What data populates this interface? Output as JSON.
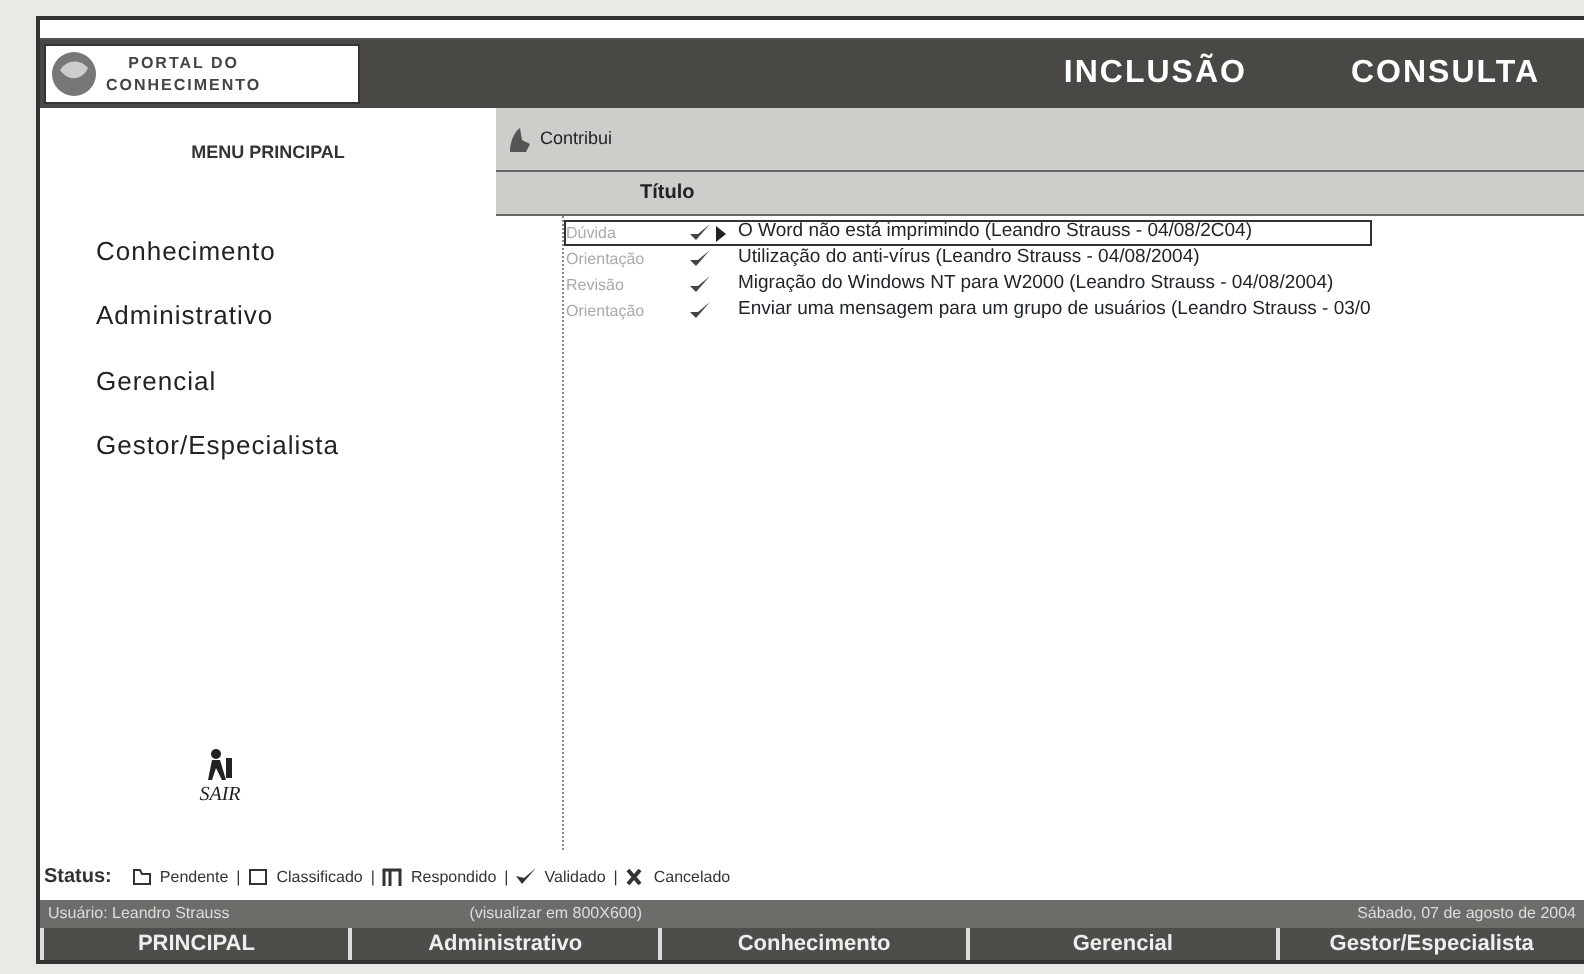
{
  "header": {
    "logo_text": [
      "PORTAL DO",
      "CONHECIMENTO"
    ],
    "links": [
      "INCLUSÃO",
      "CONSULTA"
    ]
  },
  "sidebar": {
    "title": "MENU PRINCIPAL",
    "items": [
      "Conhecimento",
      "Administrativo",
      "Gerencial",
      "Gestor/Especialista"
    ],
    "exit": "SAIR"
  },
  "toolbar": {
    "button": "Contribui"
  },
  "table": {
    "column": "Título",
    "rows": [
      {
        "category": "Dúvida",
        "title": "O Word não está imprimindo  (Leandro Strauss - 04/08/2C04)",
        "selected": true
      },
      {
        "category": "Orientação",
        "title": "Utilização do anti-vírus (Leandro Strauss - 04/08/2004)",
        "selected": false
      },
      {
        "category": "Revisão",
        "title": "Migração do Windows NT para W2000 (Leandro Strauss - 04/08/2004)",
        "selected": false
      },
      {
        "category": "Orientação",
        "title": "Enviar uma mensagem para um grupo de usuários (Leandro Strauss - 03/0",
        "selected": false
      }
    ]
  },
  "status": {
    "label": "Status:",
    "separator": "|",
    "items": [
      {
        "kind": "pending",
        "text": "Pendente"
      },
      {
        "kind": "classified",
        "text": "Classificado"
      },
      {
        "kind": "answered",
        "text": "Respondido"
      },
      {
        "kind": "validated",
        "text": "Validado"
      },
      {
        "kind": "cancelled",
        "text": "Cancelado"
      }
    ]
  },
  "user_bar": {
    "user": "Usuário: Leandro Strauss",
    "note": "(visualizar em 800X600)",
    "date": "Sábado, 07 de agosto de 2004"
  },
  "nav": [
    "PRINCIPAL",
    "Administrativo",
    "Conhecimento",
    "Gerencial",
    "Gestor/Especialista"
  ]
}
